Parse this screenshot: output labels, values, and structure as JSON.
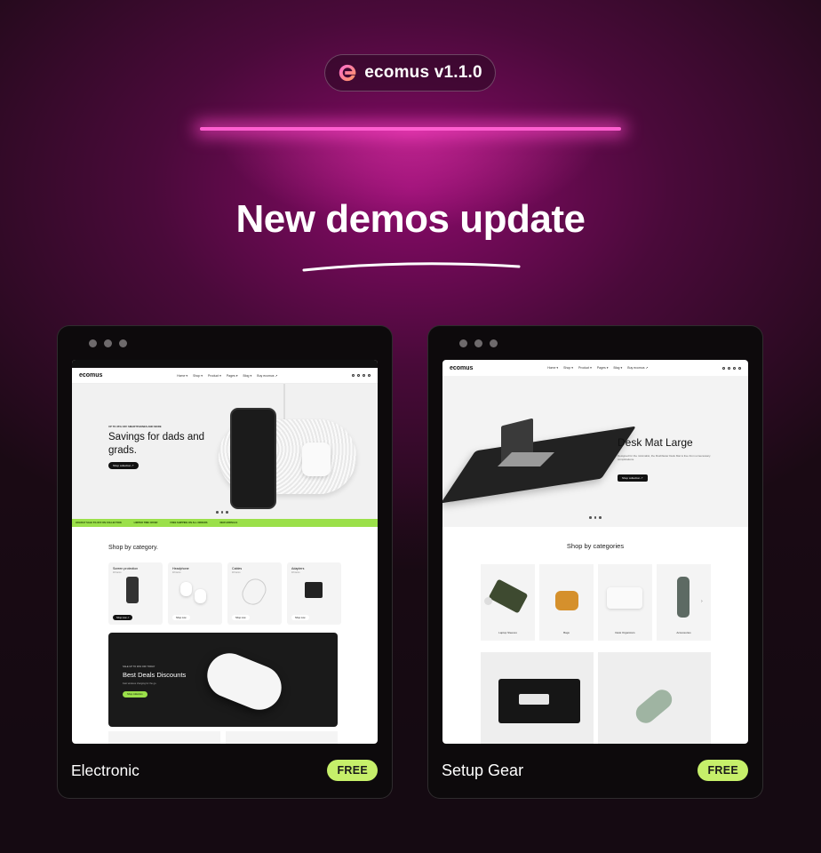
{
  "brand": {
    "name": "ecomus v1.1.0"
  },
  "headline": "New demos update",
  "colors": {
    "accent": "#ff5fd0",
    "badge": "#c6ef6a",
    "bg_dark": "#150a12"
  },
  "cards": [
    {
      "title": "Electronic",
      "badge": "FREE",
      "site": {
        "logo": "ecomus",
        "menu": [
          "Home ▾",
          "Shop ▾",
          "Product ▾",
          "Pages ▾",
          "Blog ▾",
          "Buy ecomus ↗"
        ],
        "hero": {
          "eyebrow": "UP TO 35% OFF SMARTPHONES AND MORE",
          "title": "Savings for dads and grads.",
          "button": "Shop collection ↗"
        },
        "ticker": [
          "HOLIDAY SALE 5% OFF ON COLLECTION",
          "LIMITED TIME OFFER",
          "FREE SHIPPING ON ALL ORDERS",
          "NEW ARRIVALS"
        ],
        "categories_title": "Shop by category.",
        "categories": [
          {
            "name": "Screen protection",
            "count": "18 items",
            "button": "Shop now ↗"
          },
          {
            "name": "Headphone",
            "count": "18 items",
            "button": "Shop now"
          },
          {
            "name": "Cables",
            "count": "18 items",
            "button": "Shop now"
          },
          {
            "name": "Adapters",
            "count": "18 items",
            "button": "Shop now"
          }
        ],
        "promo": {
          "eyebrow": "SALE UP TO 30% OFF TODAY",
          "title": "Best Deals Discounts",
          "desc": "Fast wireless charging for the go.",
          "button": "Shop collection"
        }
      }
    },
    {
      "title": "Setup Gear",
      "badge": "FREE",
      "site": {
        "logo": "ecomus",
        "menu": [
          "Home ▾",
          "Shop ▾",
          "Product ▾",
          "Pages ▾",
          "Blog ▾",
          "Buy ecomus ↗"
        ],
        "hero": {
          "title": "Desk Mat Large",
          "desc": "Designed for the minimalist, the Rushfaster Desk Mat is free from unnecessary complications.",
          "button": "Shop collection ↗"
        },
        "categories_title": "Shop by categories",
        "categories": [
          "Laptop Sleeves",
          "Bags",
          "Desk Organizers",
          "Accessories"
        ]
      }
    }
  ]
}
